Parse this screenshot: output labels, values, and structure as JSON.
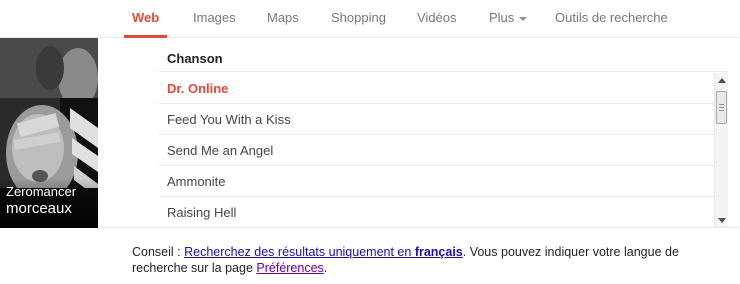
{
  "nav": {
    "tabs": [
      {
        "label": "Web",
        "active": true
      },
      {
        "label": "Images"
      },
      {
        "label": "Maps"
      },
      {
        "label": "Shopping"
      },
      {
        "label": "Vidéos"
      },
      {
        "label": "Plus"
      },
      {
        "label": "Outils de recherche"
      }
    ]
  },
  "artist": {
    "name": "Zeromancer",
    "subtitle": "morceaux"
  },
  "songs": {
    "header": "Chanson",
    "items": [
      "Dr. Online",
      "Feed You With a Kiss",
      "Send Me an Angel",
      "Ammonite",
      "Raising Hell"
    ]
  },
  "tip": {
    "prefix": "Conseil : ",
    "link1": "Recherchez des résultats uniquement en ",
    "link1_bold": "français",
    "middle": ". Vous pouvez indiquer votre langue de recherche sur la page ",
    "link2": "Préférences",
    "suffix": "."
  },
  "colors": {
    "accent": "#dd4b39",
    "link": "#1a0dab",
    "visited": "#660099"
  }
}
